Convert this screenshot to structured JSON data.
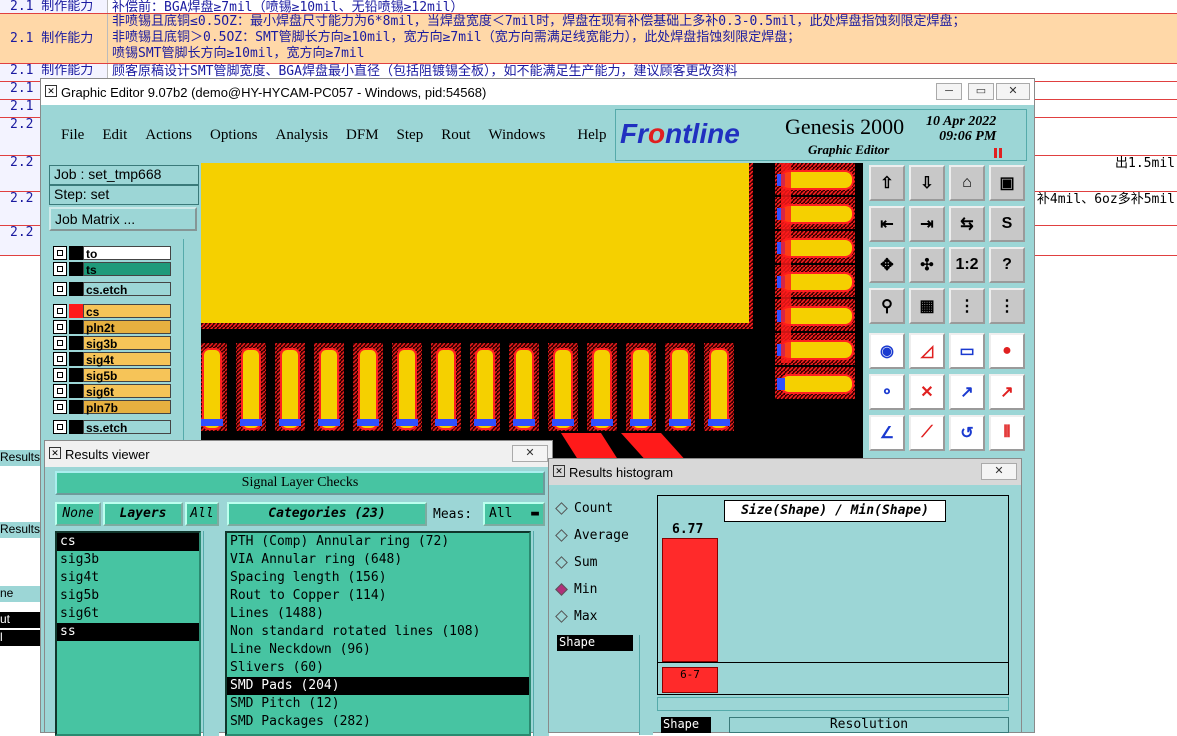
{
  "background_doc": {
    "rows": [
      {
        "section": "2.1 制作能力",
        "text": "补偿前：BGA焊盘≥7mil（喷锡≥10mil、无铅喷锡≥12mil）",
        "highlight": false
      },
      {
        "section": "2.1 制作能力",
        "text": "非喷锡且底铜≤0.5OZ：最小焊盘尺寸能力为6*8mil，当焊盘宽度＜7mil时，焊盘在现有补偿基础上多补0.3-0.5mil，此处焊盘指蚀刻限定焊盘；\n非喷锡且底铜＞0.5OZ：SMT管脚长方向≥10mil，宽方向≥7mil（宽方向需满足线宽能力），此处焊盘指蚀刻限定焊盘；\n喷锡SMT管脚长方向≥10mil，宽方向≥7mil",
        "highlight": true
      },
      {
        "section": "2.1 制作能力",
        "text": "顾客原稿设计SMT管脚宽度、BGA焊盘最小直径（包括阻镀锡全板），如不能满足生产能力，建议顾客更改资料",
        "highlight": false
      },
      {
        "section": "2.1",
        "text": "",
        "highlight": false
      },
      {
        "section": "2.1",
        "text": "",
        "highlight": false
      },
      {
        "section": "2.2 BGA",
        "text": "",
        "highlight": false
      },
      {
        "section": "2.2 BGA",
        "text": "出1.5mil",
        "highlight": false
      },
      {
        "section": "2.2 BGA",
        "text": "补4mil、6oz多补5mil",
        "highlight": false
      },
      {
        "section": "2.2 BGA",
        "text": "",
        "highlight": false
      }
    ],
    "left_fragments": [
      "Results v",
      "Results v",
      "ne",
      "ut",
      "l"
    ]
  },
  "graphic_editor": {
    "title": "Graphic Editor 9.07b2 (demo@HY-HYCAM-PC057 - Windows, pid:54568)",
    "menu": [
      "File",
      "Edit",
      "Actions",
      "Options",
      "Analysis",
      "DFM",
      "Step",
      "Rout",
      "Windows",
      "Help"
    ],
    "brand": {
      "logo_a": "Fr",
      "logo_b": "o",
      "logo_c": "ntline",
      "product": "Genesis 2000",
      "subtitle": "Graphic Editor",
      "date": "10 Apr 2022",
      "time": "09:06 PM"
    },
    "job": "Job : set_tmp668",
    "step": "Step: set",
    "job_matrix_label": "Job Matrix ...",
    "layers": [
      {
        "name": "to",
        "color": "#000000",
        "fill": "#ffffff"
      },
      {
        "name": "ts",
        "color": "#000000",
        "fill": "#1f9a7a"
      },
      {
        "name": "cs.etch",
        "color": "#000000",
        "fill": "#9cd6d6"
      },
      {
        "name": "cs",
        "color": "#ff1a1a",
        "fill": "#f6c458"
      },
      {
        "name": "pln2t",
        "color": "#000000",
        "fill": "#e6b040"
      },
      {
        "name": "sig3b",
        "color": "#000000",
        "fill": "#f6c458"
      },
      {
        "name": "sig4t",
        "color": "#000000",
        "fill": "#f6c458"
      },
      {
        "name": "sig5b",
        "color": "#000000",
        "fill": "#f6c458"
      },
      {
        "name": "sig6t",
        "color": "#000000",
        "fill": "#f6c458"
      },
      {
        "name": "pln7b",
        "color": "#000000",
        "fill": "#e6b040"
      },
      {
        "name": "ss.etch",
        "color": "#000000",
        "fill": "#9cd6d6"
      }
    ],
    "tool_icons": [
      "zoom-in-icon",
      "zoom-out-icon",
      "home-icon",
      "window-icon",
      "pan-left-icon",
      "pan-right-icon",
      "swap-icon",
      "snap-icon",
      "fit-icon",
      "center-icon",
      "scale-icon",
      "help-icon",
      "measure-icon",
      "grid-icon",
      "drc-icon",
      "drc-alt-icon",
      "pad-add-icon",
      "line-add-icon",
      "ruler-icon",
      "circle-icon",
      "connect-icon",
      "cross-icon",
      "pin-icon",
      "point-icon",
      "draw-line-icon",
      "route-icon",
      "arc-icon",
      "net-icon"
    ],
    "tool_labels": {
      "scale": "1:2",
      "help": "?"
    }
  },
  "results_viewer": {
    "title": "Results viewer",
    "header": "Signal Layer Checks",
    "none_btn": "None",
    "layers_btn": "Layers",
    "all_btn": "All",
    "categories_btn": "Categories (23)",
    "meas_label": "Meas:",
    "meas_value": "All",
    "layers": [
      "cs",
      "sig3b",
      "sig4t",
      "sig5b",
      "sig6t",
      "ss"
    ],
    "selected_layers": [
      "cs",
      "ss"
    ],
    "categories": [
      "PTH (Comp) Annular ring (72)",
      "VIA Annular ring (648)",
      "Spacing length (156)",
      "Rout to Copper (114)",
      "Lines (1488)",
      "Non standard rotated lines (108)",
      "Line Neckdown (96)",
      "Slivers (60)",
      "SMD Pads (204)",
      "SMD Pitch (12)",
      "SMD Packages (282)"
    ],
    "selected_category": "SMD Pads (204)"
  },
  "results_histogram": {
    "title": "Results histogram",
    "options": [
      {
        "label": "Count",
        "on": false
      },
      {
        "label": "Average",
        "on": false
      },
      {
        "label": "Sum",
        "on": false
      },
      {
        "label": "Min",
        "on": true
      },
      {
        "label": "Max",
        "on": false
      }
    ],
    "shape_label": "Shape",
    "chart_title": "Size(Shape) / Min(Shape)",
    "bar_value": "6.77",
    "bin_label": "6-7",
    "shape_col": "Shape",
    "resolution_col": "Resolution",
    "accent": "#ff2a2a"
  }
}
